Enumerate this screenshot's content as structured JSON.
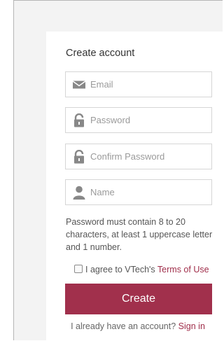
{
  "form": {
    "title": "Create account",
    "email_placeholder": "Email",
    "password_placeholder": "Password",
    "confirm_placeholder": "Confirm Password",
    "name_placeholder": "Name",
    "hint": "Password must contain 8 to 20 characters, at least 1 uppercase letter and 1 number.",
    "agree_prefix": "I agree to VTech's",
    "terms_link": "Terms of Use",
    "agree_checked": false,
    "create_label": "Create",
    "signin_prefix": "I already have an account?",
    "signin_link": "Sign in"
  },
  "icons": {
    "email": "envelope-icon",
    "password": "lock-icon",
    "confirm": "lock-icon",
    "name": "person-icon"
  },
  "colors": {
    "accent": "#a1304c",
    "link": "#a02f4b",
    "icon": "#888888",
    "background": "#f3f3f3"
  }
}
